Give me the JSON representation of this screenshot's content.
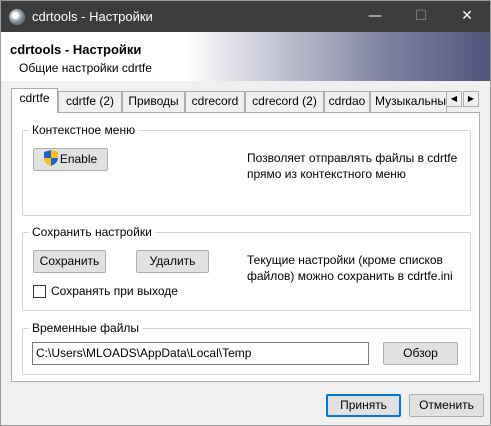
{
  "window": {
    "title": "cdrtools - Настройки",
    "min_glyph": "—",
    "max_glyph": "☐",
    "close_glyph": "✕"
  },
  "header": {
    "title": "cdrtools - Настройки",
    "subtitle": "Общие настройки cdrtfe"
  },
  "tabs": [
    {
      "label": "cdrtfe",
      "active": true
    },
    {
      "label": "cdrtfe (2)"
    },
    {
      "label": "Приводы"
    },
    {
      "label": "cdrecord"
    },
    {
      "label": "cdrecord (2)"
    },
    {
      "label": "cdrdao"
    },
    {
      "label": "Музыкальны"
    }
  ],
  "tab_scroll": {
    "left": "◀",
    "right": "▶"
  },
  "context_menu": {
    "title": "Контекстное меню",
    "enable_label": "Enable",
    "description_line1": "Позволяет отправлять файлы в cdrtfe",
    "description_line2": "прямо из контекстного меню",
    "icon": "uac-shield-icon"
  },
  "save_settings": {
    "title": "Сохранить настройки",
    "save_label": "Сохранить",
    "delete_label": "Удалить",
    "description_line1": "Текущие настройки (кроме списков",
    "description_line2": "файлов) можно сохранить в cdrtfe.ini",
    "checkbox_label": "Сохранять при выходе",
    "checkbox_checked": false
  },
  "temp_files": {
    "title": "Временные файлы",
    "path_value": "C:\\Users\\MLOADS\\AppData\\Local\\Temp",
    "browse_label": "Обзор"
  },
  "footer": {
    "ok_label": "Принять",
    "cancel_label": "Отменить"
  }
}
